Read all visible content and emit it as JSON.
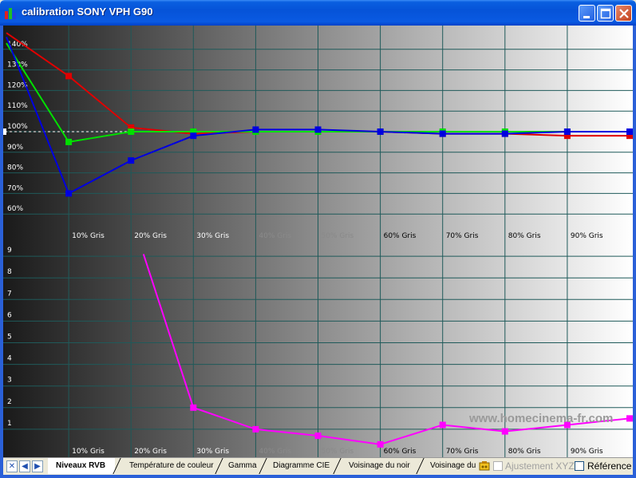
{
  "window": {
    "title": "calibration SONY VPH G90"
  },
  "watermark": "www.homecinema-fr.com",
  "colors": {
    "red": "#e00000",
    "green": "#00e000",
    "blue": "#0000e0",
    "magenta": "#ff00ff",
    "grid": "#1f5a5a",
    "reference_line": "#ffffff"
  },
  "chart_data": [
    {
      "type": "line",
      "title": "",
      "xlabel": "",
      "ylabel": "",
      "x_tick_labels": [
        "10% Gris",
        "20% Gris",
        "30% Gris",
        "40% Gris",
        "50% Gris",
        "60% Gris",
        "70% Gris",
        "80% Gris",
        "90% Gris"
      ],
      "y_tick_labels": [
        "60%",
        "70%",
        "80%",
        "90%",
        "100%",
        "110%",
        "120%",
        "130%",
        "140%"
      ],
      "x": [
        0,
        10,
        20,
        30,
        40,
        50,
        60,
        70,
        80,
        90,
        100
      ],
      "ylim": [
        55,
        152
      ],
      "reference": 100,
      "grid": true,
      "series": [
        {
          "color": "#e00000",
          "values": [
            148,
            127,
            102,
            99,
            100,
            100,
            100,
            99,
            99,
            98,
            98
          ]
        },
        {
          "color": "#00e000",
          "values": [
            143,
            95,
            100,
            100,
            100,
            100,
            100,
            100,
            100,
            100,
            100
          ]
        },
        {
          "color": "#0000e0",
          "values": [
            146,
            70,
            86,
            98,
            101,
            101,
            100,
            99,
            99,
            100,
            100
          ]
        }
      ]
    },
    {
      "type": "line",
      "title": "",
      "xlabel": "",
      "ylabel": "",
      "x_tick_labels": [
        "10% Gris",
        "20% Gris",
        "30% Gris",
        "40% Gris",
        "50% Gris",
        "60% Gris",
        "70% Gris",
        "80% Gris",
        "90% Gris"
      ],
      "y_tick_labels": [
        "1",
        "2",
        "3",
        "4",
        "5",
        "6",
        "7",
        "8",
        "9"
      ],
      "ylim": [
        0,
        10
      ],
      "grid": true,
      "series": [
        {
          "color": "#ff00ff",
          "x": [
            22,
            30,
            40,
            50,
            60,
            70,
            80,
            90,
            100
          ],
          "values": [
            9.1,
            2.0,
            1.0,
            0.7,
            0.3,
            1.2,
            0.9,
            1.2,
            1.5
          ]
        }
      ]
    }
  ],
  "tabs": [
    {
      "label": "Niveaux RVB",
      "active": true
    },
    {
      "label": "Température de couleur",
      "active": false
    },
    {
      "label": "Gamma",
      "active": false
    },
    {
      "label": "Diagramme CIE",
      "active": false
    },
    {
      "label": "Voisinage du noir",
      "active": false
    },
    {
      "label": "Voisinage du b",
      "active": false
    }
  ],
  "nav": {
    "close": "✕",
    "prev": "◀",
    "next": "▶"
  },
  "options": {
    "ajustement_label": "Ajustement XYZ",
    "reference_label": "Référence"
  }
}
